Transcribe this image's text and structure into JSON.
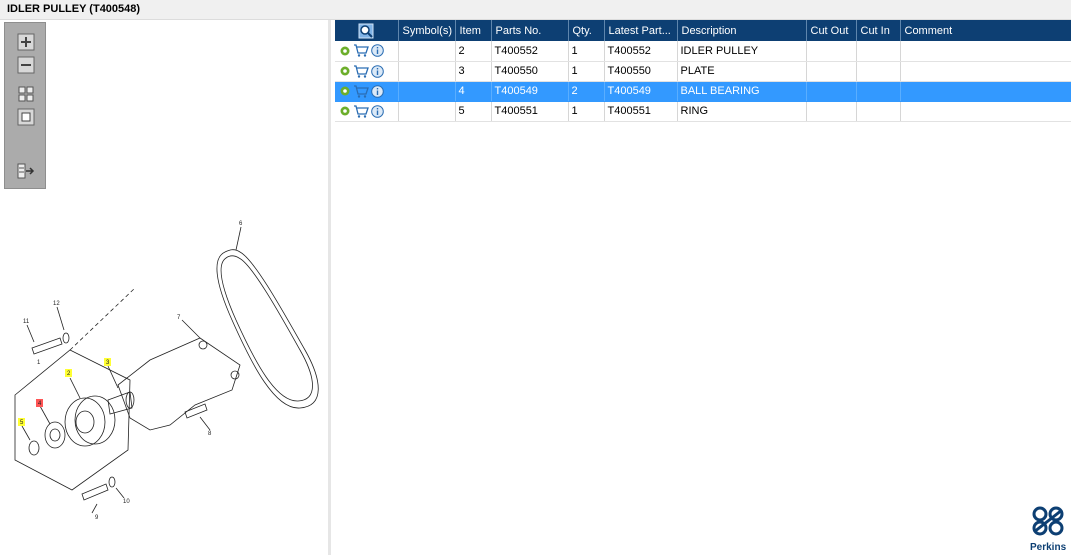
{
  "title": "IDLER PULLEY (T400548)",
  "toolbar": {
    "icons": [
      "zoom-in-icon",
      "zoom-out-icon",
      "fit-all-icon",
      "fit-page-icon",
      "export-icon"
    ]
  },
  "table": {
    "columns": [
      "Symbol(s)",
      "Item",
      "Parts No.",
      "Qty.",
      "Latest Part...",
      "Description",
      "Cut Out",
      "Cut In",
      "Comment"
    ],
    "rows": [
      {
        "item": "2",
        "part": "T400552",
        "qty": "1",
        "latest": "T400552",
        "desc": "IDLER PULLEY",
        "cut_out": "",
        "cut_in": "",
        "comment": ""
      },
      {
        "item": "3",
        "part": "T400550",
        "qty": "1",
        "latest": "T400550",
        "desc": "PLATE",
        "cut_out": "",
        "cut_in": "",
        "comment": ""
      },
      {
        "item": "4",
        "part": "T400549",
        "qty": "2",
        "latest": "T400549",
        "desc": "BALL BEARING",
        "cut_out": "",
        "cut_in": "",
        "comment": ""
      },
      {
        "item": "5",
        "part": "T400551",
        "qty": "1",
        "latest": "T400551",
        "desc": "RING",
        "cut_out": "",
        "cut_in": "",
        "comment": ""
      }
    ],
    "selected_row": 2
  },
  "diagram": {
    "labels": [
      "1",
      "2",
      "3",
      "4",
      "5",
      "6",
      "7",
      "8",
      "9",
      "10",
      "11",
      "12"
    ],
    "highlight_yellow": "#ffff33",
    "highlight_red": "#ff5555"
  },
  "logo": {
    "text": "Perkins"
  },
  "colors": {
    "header": "#0d3f73",
    "selected": "#3399ff",
    "accent_green": "#6cae2a"
  }
}
